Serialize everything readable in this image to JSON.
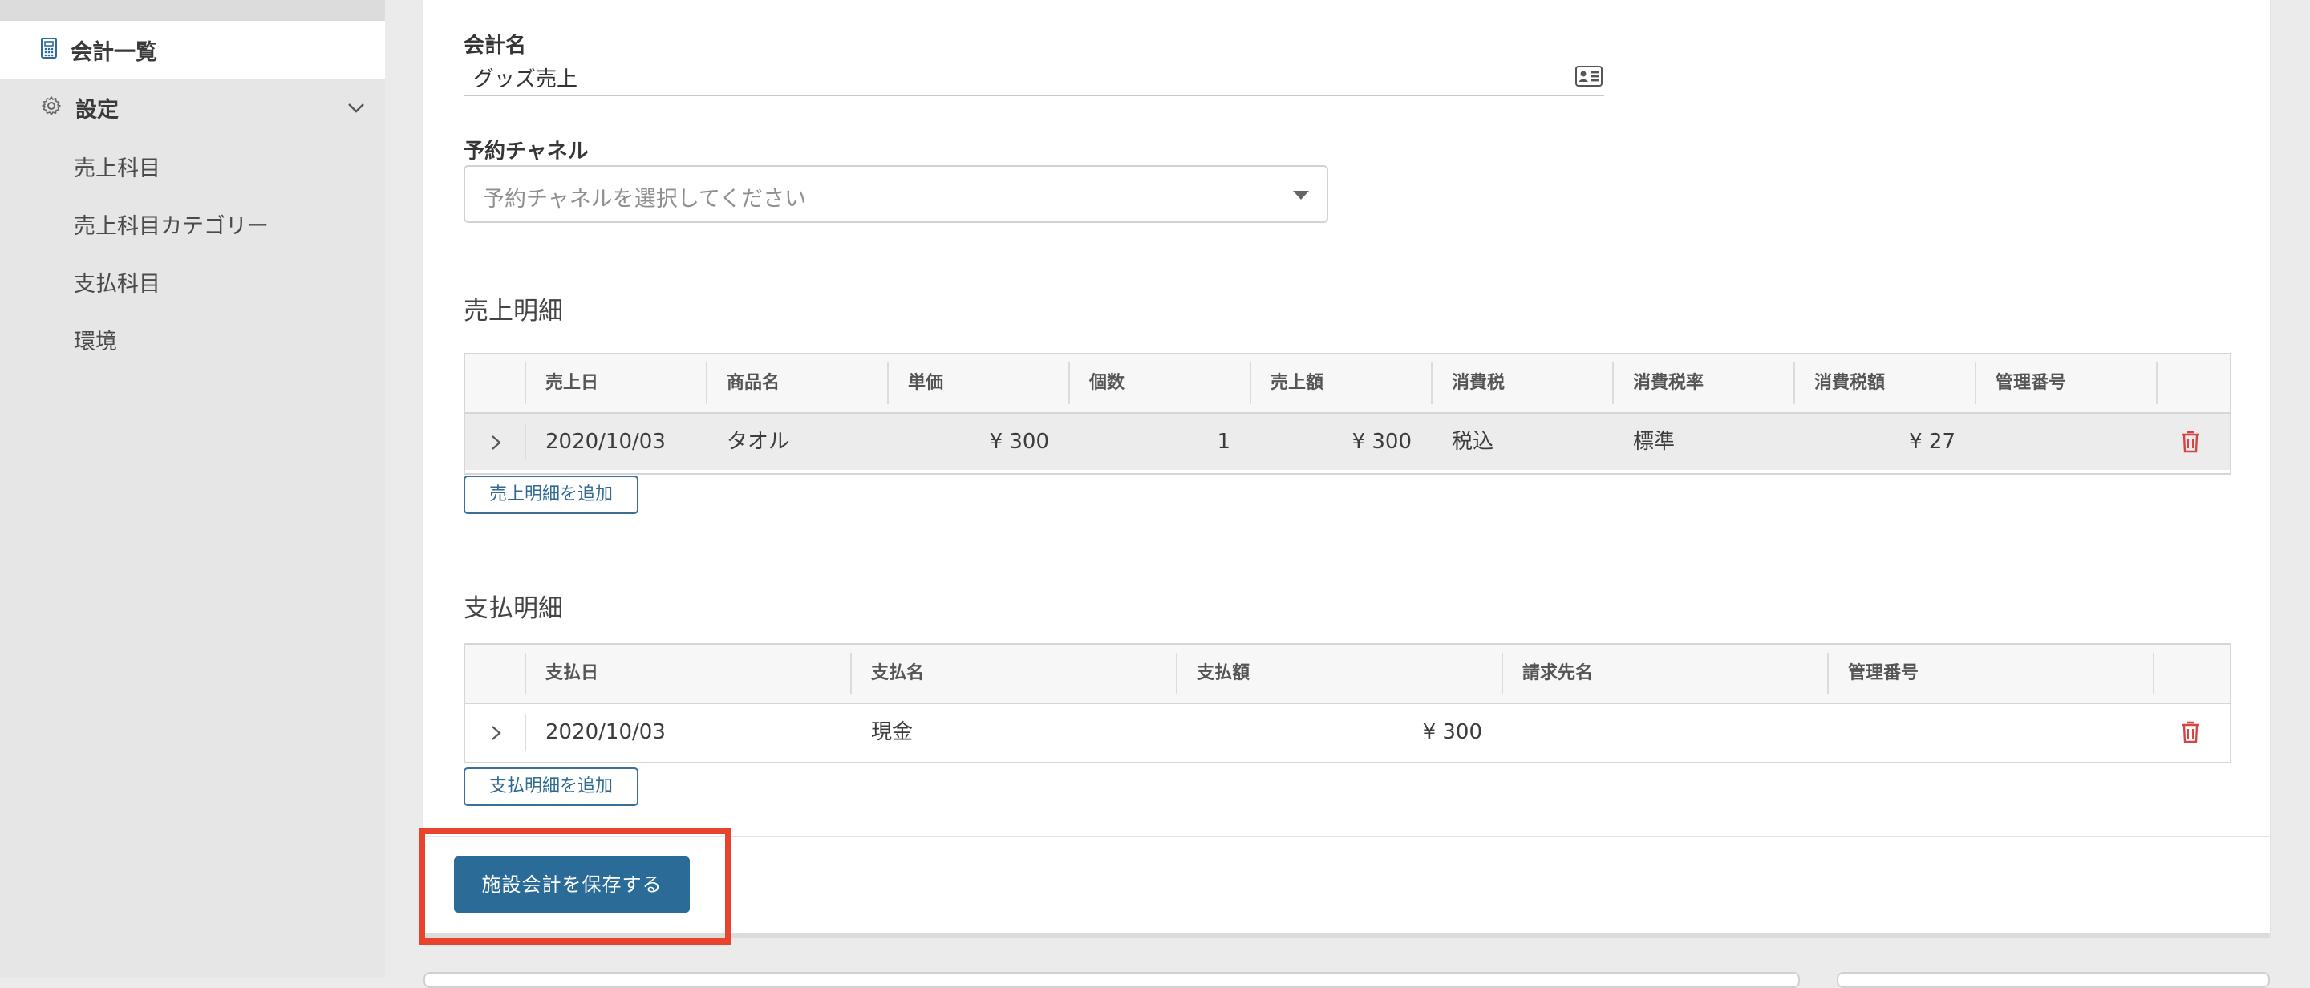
{
  "sidebar": {
    "active_item": {
      "label": "会計一覧",
      "icon": "calculator-icon"
    },
    "settings": {
      "label": "設定",
      "icon": "gear-icon",
      "expand_icon": "chevron-down-icon"
    },
    "sub_items": [
      {
        "label": "売上科目"
      },
      {
        "label": "売上科目カテゴリー"
      },
      {
        "label": "支払科目"
      },
      {
        "label": "環境"
      }
    ]
  },
  "form": {
    "account_name_label": "会計名",
    "account_name_value": "グッズ売上",
    "channel_label": "予約チャネル",
    "channel_placeholder": "予約チャネルを選択してください"
  },
  "sales": {
    "title": "売上明細",
    "columns": [
      "売上日",
      "商品名",
      "単価",
      "個数",
      "売上額",
      "消費税",
      "消費税率",
      "消費税額",
      "管理番号"
    ],
    "rows": [
      {
        "date": "2020/10/03",
        "product": "タオル",
        "unit_price": "¥ 300",
        "quantity": "1",
        "amount": "¥ 300",
        "tax": "税込",
        "tax_rate": "標準",
        "tax_amount": "¥ 27",
        "ref_no": ""
      }
    ],
    "add_label": "売上明細を追加"
  },
  "payments": {
    "title": "支払明細",
    "columns": [
      "支払日",
      "支払名",
      "支払額",
      "請求先名",
      "管理番号"
    ],
    "rows": [
      {
        "date": "2020/10/03",
        "name": "現金",
        "amount": "¥ 300",
        "billing_name": "",
        "ref_no": ""
      }
    ],
    "add_label": "支払明細を追加"
  },
  "save_label": "施設会計を保存する",
  "colors": {
    "primary": "#2b6b98",
    "danger": "#d64541",
    "highlight": "#e8432d"
  }
}
